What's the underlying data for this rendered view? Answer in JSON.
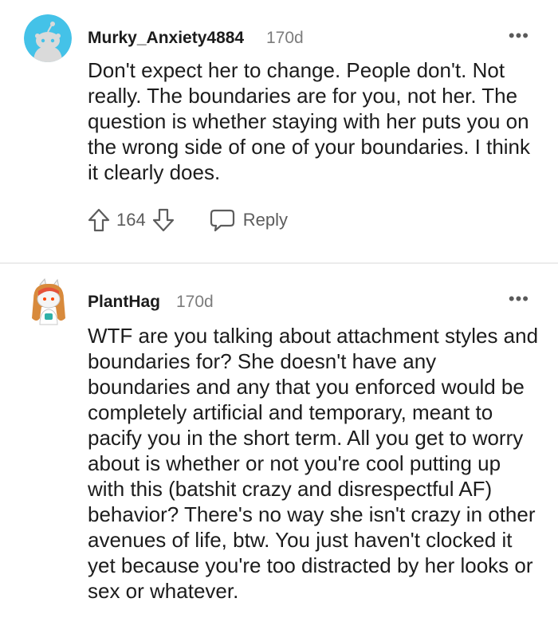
{
  "comments": [
    {
      "username": "Murky_Anxiety4884",
      "age": "170d",
      "more_label": "•••",
      "body": "Don't expect her to change. People don't. Not really. The boundaries are for you, not her. The question is whether staying with her puts you on the wrong side of one of your boundaries. I think it clearly does.",
      "score": "164",
      "reply_label": "Reply",
      "avatar_color": "#44c2e8"
    },
    {
      "username": "PlantHag",
      "age": "170d",
      "more_label": "•••",
      "body": "WTF are you talking about attachment styles and boundaries for? She doesn't have any boundaries and any that you enforced would be completely artificial and temporary, meant to pacify you in the short term. All you get to worry about is whether or not you're cool putting up with this (batshit crazy and disrespectful AF) behavior? There's no way she isn't crazy in other avenues of life, btw. You just haven't clocked it yet because you're too distracted by her looks or sex or whatever."
    }
  ],
  "colors": {
    "text": "#1c1c1c",
    "meta": "#7c7c7c",
    "icon": "#5c5c5c",
    "divider": "#ececec"
  }
}
